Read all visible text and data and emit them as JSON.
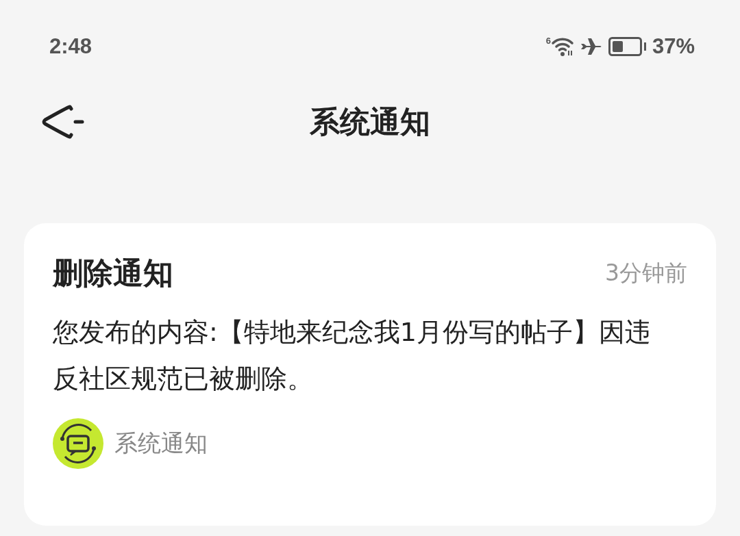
{
  "status_bar": {
    "time": "2:48",
    "wifi_badge": "6",
    "battery_percent": "37%"
  },
  "header": {
    "title": "系统通知"
  },
  "notifications": [
    {
      "title": "删除通知",
      "time": "3分钟前",
      "body": "您发布的内容:【特地来纪念我1月份写的帖子】因违反社区规范已被删除。",
      "sender": "系统通知"
    }
  ]
}
